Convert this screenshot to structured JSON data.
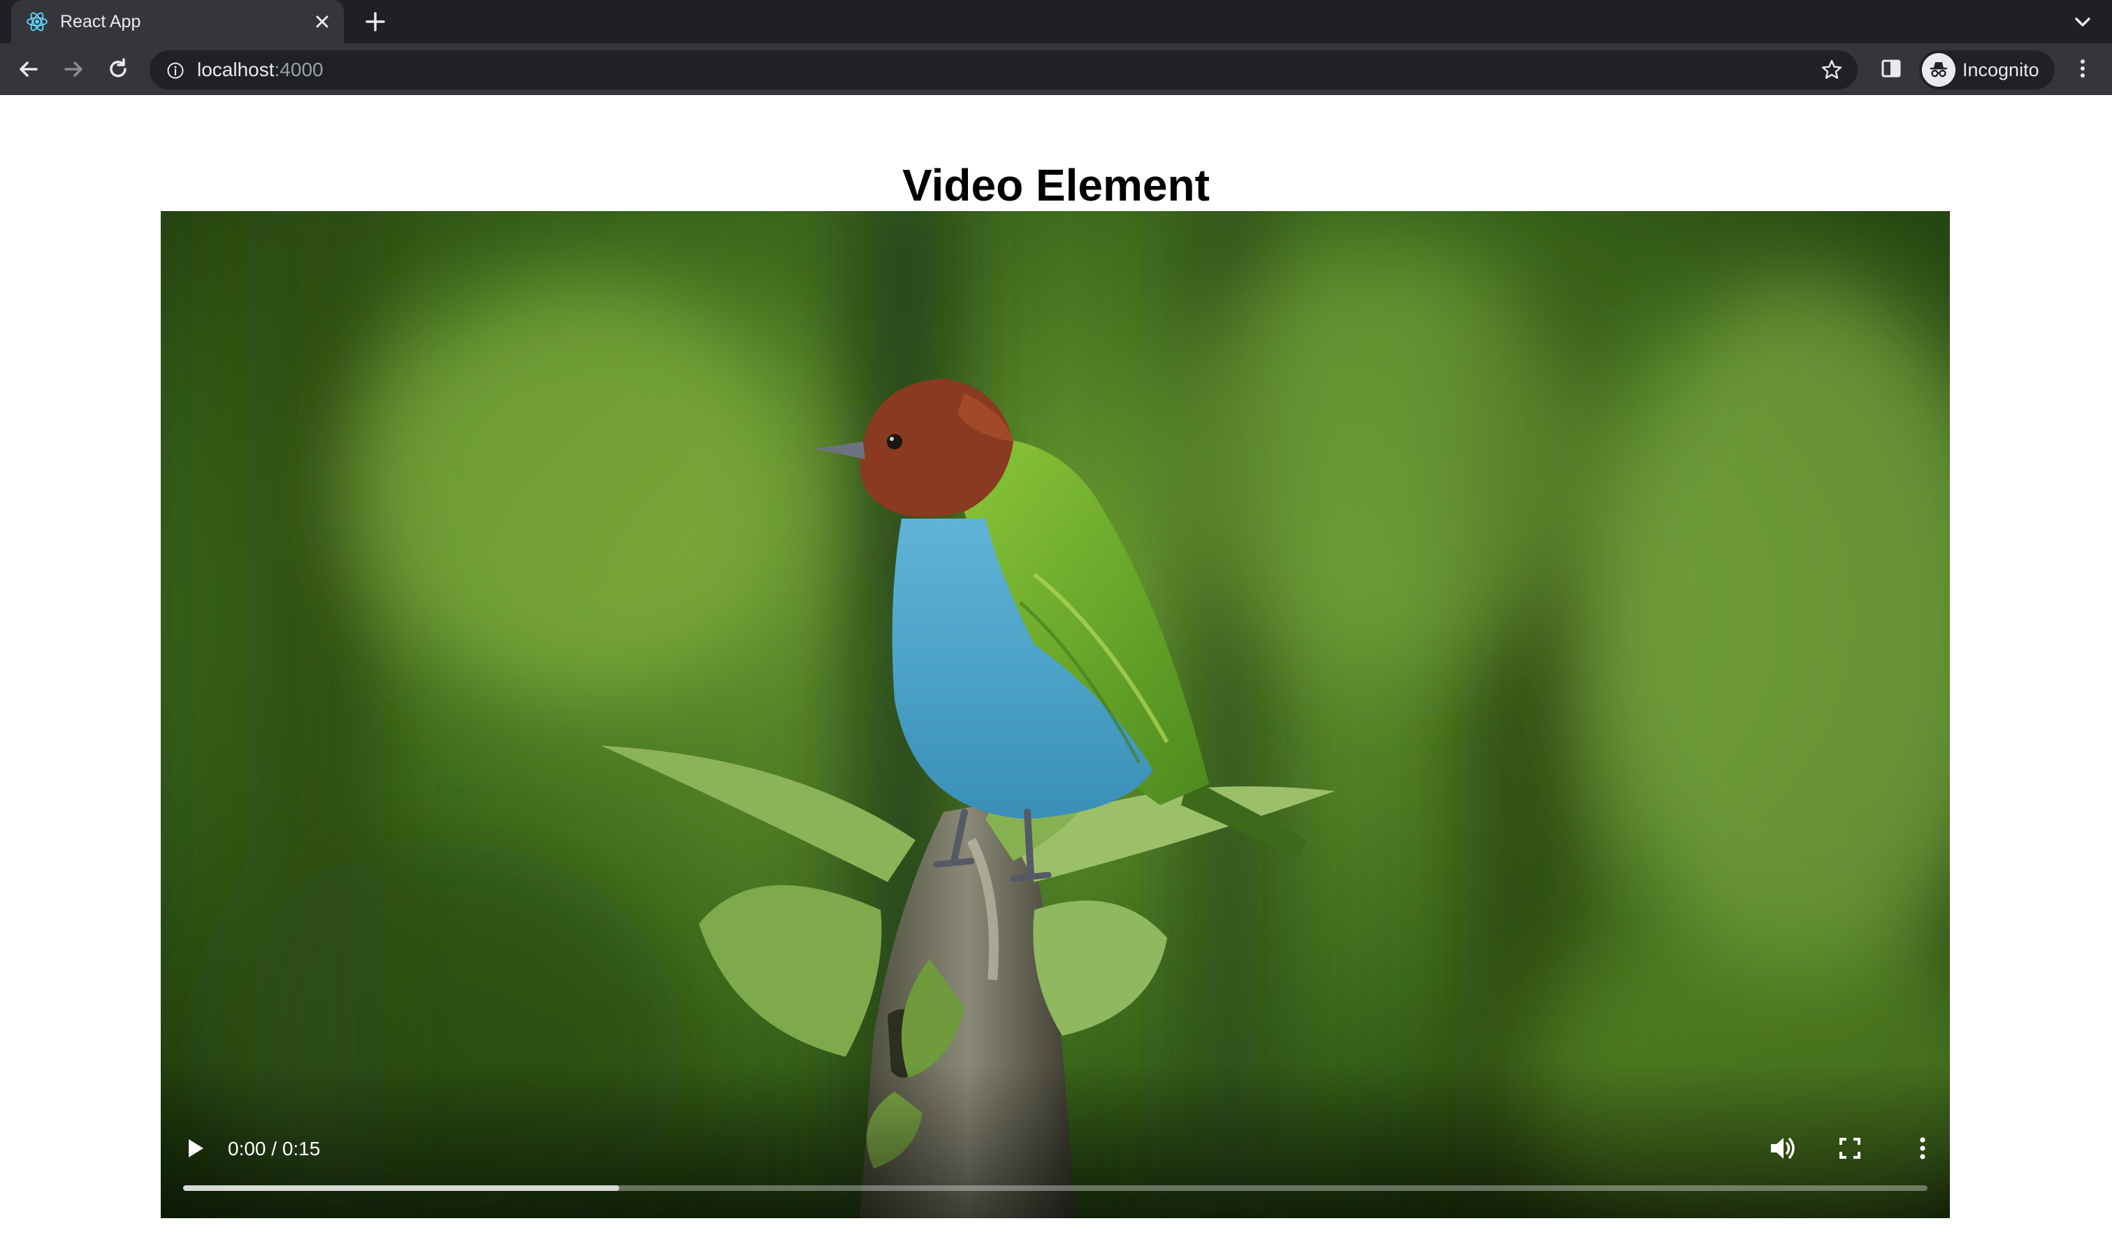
{
  "browser": {
    "tab": {
      "title": "React App"
    },
    "address": {
      "host": "localhost",
      "port": ":4000"
    },
    "profile": {
      "label": "Incognito"
    }
  },
  "page": {
    "title": "Video Element"
  },
  "video": {
    "time_display": "0:00 / 0:15",
    "buffered_fraction": 0.25
  },
  "colors": {
    "chrome_dark": "#1f2023",
    "toolbar": "#35363a",
    "omnibox": "#202124",
    "icon": "#e8eaed"
  }
}
